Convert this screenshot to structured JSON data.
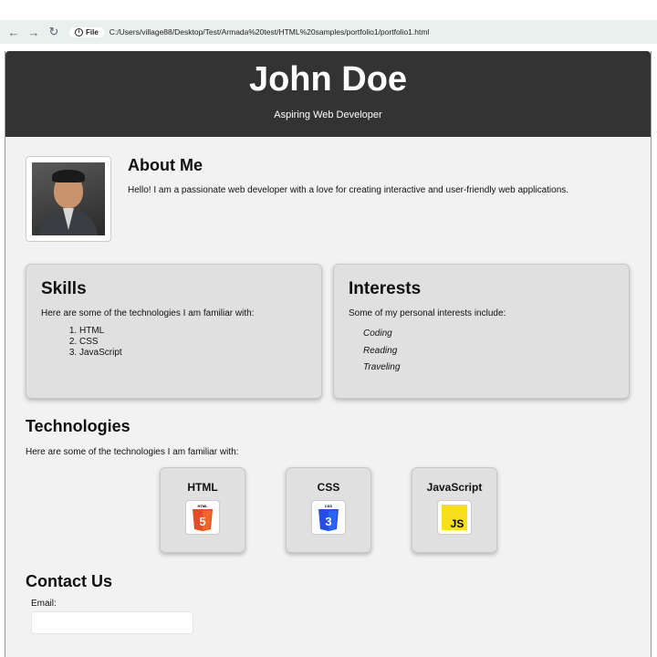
{
  "browser": {
    "back_icon": "arrow-left-icon",
    "forward_icon": "arrow-right-icon",
    "reload_icon": "reload-icon",
    "file_chip_label": "File",
    "url": "C:/Users/village88/Desktop/Test/Armada%20test/HTML%20samples/portfolio1/portfolio1.html"
  },
  "header": {
    "name": "John Doe",
    "tagline": "Aspiring Web Developer",
    "background_color": "#333333"
  },
  "about": {
    "title": "About Me",
    "text": "Hello! I am a passionate web developer with a love for creating interactive and user-friendly web applications."
  },
  "skills": {
    "title": "Skills",
    "intro": "Here are some of the technologies I am familiar with:",
    "items": [
      "HTML",
      "CSS",
      "JavaScript"
    ]
  },
  "interests": {
    "title": "Interests",
    "intro": "Some of my personal interests include:",
    "items": [
      "Coding",
      "Reading",
      "Traveling"
    ]
  },
  "technologies": {
    "title": "Technologies",
    "intro": "Here are some of the technologies I am familiar with:",
    "cards": [
      {
        "name": "HTML",
        "logo_text": "5",
        "logo_caption": "HTML",
        "color": "#e44d26"
      },
      {
        "name": "CSS",
        "logo_text": "3",
        "logo_caption": "CSS",
        "color": "#264de4"
      },
      {
        "name": "JavaScript",
        "logo_text": "JS",
        "color": "#f7df1e"
      }
    ]
  },
  "contact": {
    "title": "Contact Us",
    "email_label": "Email:",
    "email_value": ""
  }
}
